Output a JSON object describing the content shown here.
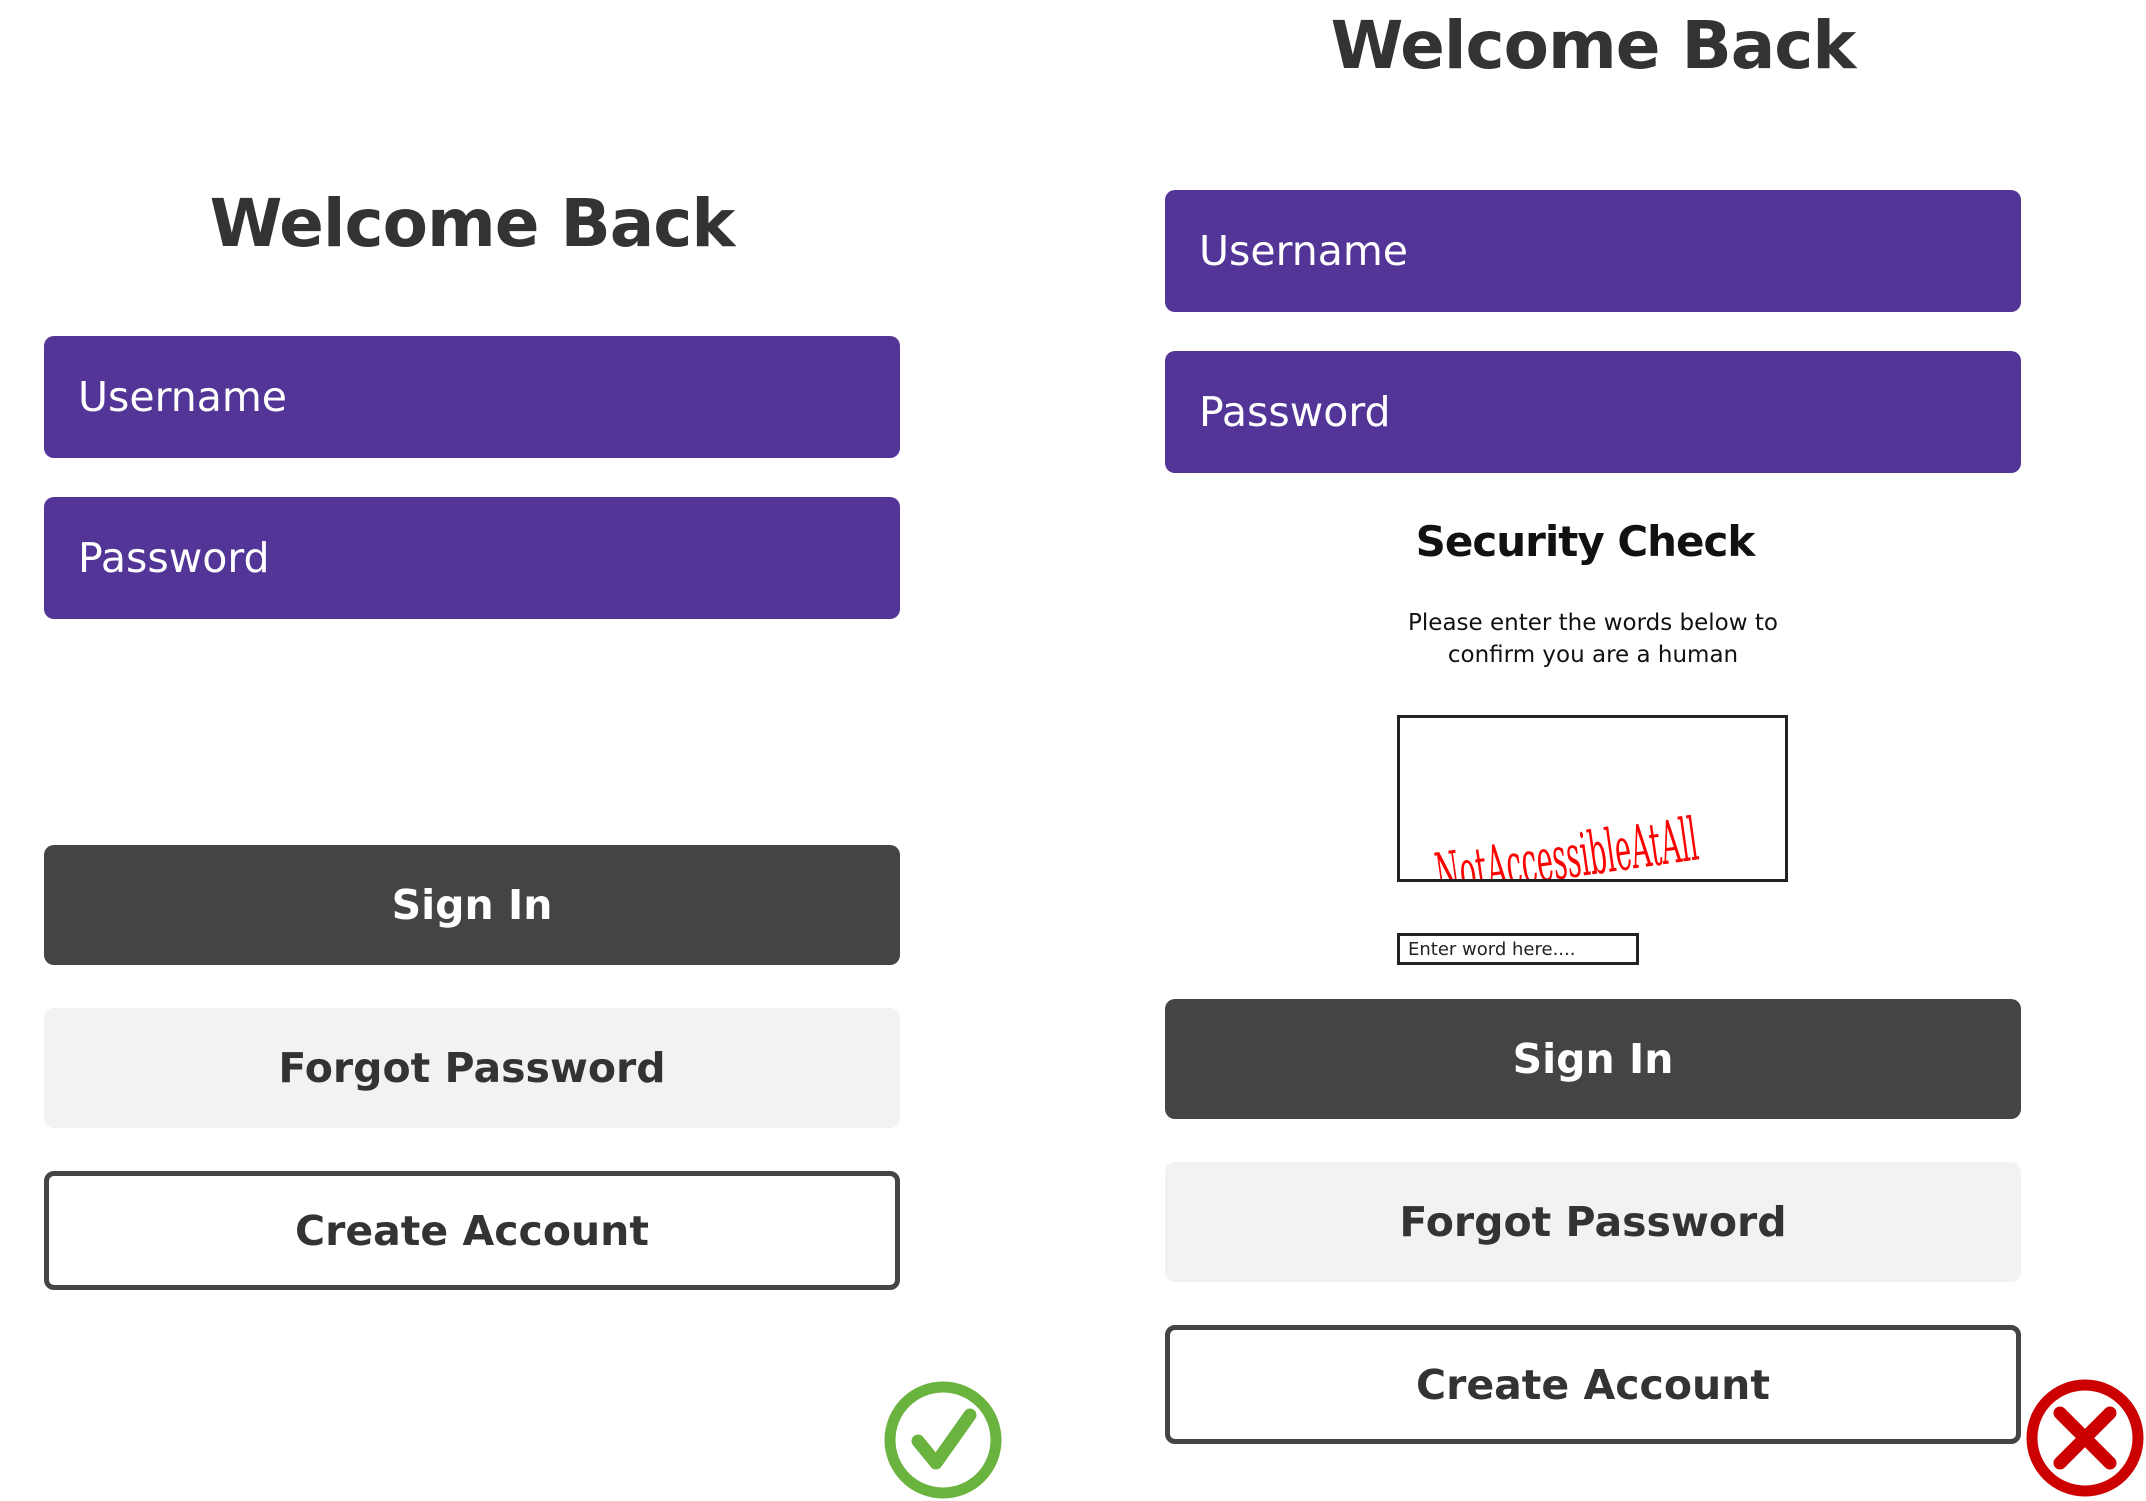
{
  "good_example": {
    "title": "Welcome Back",
    "username_placeholder": "Username",
    "password_placeholder": "Password",
    "sign_in_label": "Sign In",
    "forgot_password_label": "Forgot Password",
    "create_account_label": "Create Account",
    "verdict_icon": "check-circle-icon",
    "verdict_color": "#6ab33f"
  },
  "bad_example": {
    "title": "Welcome Back",
    "username_placeholder": "Username",
    "password_placeholder": "Password",
    "security_title": "Security Check",
    "security_text_line1": "Please enter the words below to",
    "security_text_line2": "confirm you are a human",
    "captcha_text": "NotAccessibleAtAll",
    "captcha_color": "#ff0000",
    "captcha_input_placeholder": "Enter word here....",
    "sign_in_label": "Sign In",
    "forgot_password_label": "Forgot Password",
    "create_account_label": "Create Account",
    "verdict_icon": "x-circle-icon",
    "verdict_color": "#cc0000"
  },
  "colors": {
    "field": "#523597",
    "dark_button": "#444444",
    "light_button": "#f2f2f2",
    "text": "#333333"
  }
}
